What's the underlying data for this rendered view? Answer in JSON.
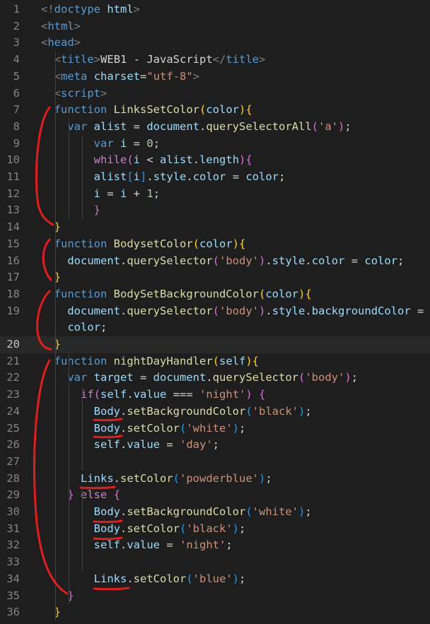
{
  "editor": {
    "current_line": 20,
    "lines": [
      {
        "n": "1",
        "tokens": [
          [
            "tok-punct",
            "<!"
          ],
          [
            "tok-tag",
            "doctype"
          ],
          [
            "tok-plain",
            " "
          ],
          [
            "tok-attr",
            "html"
          ],
          [
            "tok-punct",
            ">"
          ]
        ]
      },
      {
        "n": "2",
        "tokens": [
          [
            "tok-punct",
            "<"
          ],
          [
            "tok-tag",
            "html"
          ],
          [
            "tok-punct",
            ">"
          ]
        ]
      },
      {
        "n": "3",
        "tokens": [
          [
            "tok-punct",
            "<"
          ],
          [
            "tok-tag",
            "head"
          ],
          [
            "tok-punct",
            ">"
          ]
        ]
      },
      {
        "n": "4",
        "tokens": [
          [
            "tok-plain",
            "  "
          ],
          [
            "tok-punct",
            "<"
          ],
          [
            "tok-tag",
            "title"
          ],
          [
            "tok-punct",
            ">"
          ],
          [
            "tok-plain",
            "WEB1 - JavaScript"
          ],
          [
            "tok-punct",
            "</"
          ],
          [
            "tok-tag",
            "title"
          ],
          [
            "tok-punct",
            ">"
          ]
        ]
      },
      {
        "n": "5",
        "tokens": [
          [
            "tok-plain",
            "  "
          ],
          [
            "tok-punct",
            "<"
          ],
          [
            "tok-tag",
            "meta"
          ],
          [
            "tok-plain",
            " "
          ],
          [
            "tok-attr",
            "charset"
          ],
          [
            "tok-plain",
            "="
          ],
          [
            "tok-str",
            "\"utf-8\""
          ],
          [
            "tok-punct",
            ">"
          ]
        ]
      },
      {
        "n": "6",
        "tokens": [
          [
            "tok-plain",
            "  "
          ],
          [
            "tok-punct",
            "<"
          ],
          [
            "tok-tag",
            "script"
          ],
          [
            "tok-punct",
            ">"
          ]
        ]
      },
      {
        "n": "7",
        "tokens": [
          [
            "tok-plain",
            "  "
          ],
          [
            "tok-kw",
            "function"
          ],
          [
            "tok-plain",
            " "
          ],
          [
            "tok-fn",
            "LinksSetColor"
          ],
          [
            "tok-b1",
            "("
          ],
          [
            "tok-var",
            "color"
          ],
          [
            "tok-b1",
            ")"
          ],
          [
            "tok-b1",
            "{"
          ]
        ]
      },
      {
        "n": "8",
        "tokens": [
          [
            "tok-plain",
            "    "
          ],
          [
            "tok-kw",
            "var"
          ],
          [
            "tok-plain",
            " "
          ],
          [
            "tok-var",
            "alist"
          ],
          [
            "tok-plain",
            " = "
          ],
          [
            "tok-var",
            "document"
          ],
          [
            "tok-plain",
            "."
          ],
          [
            "tok-fn",
            "querySelectorAll"
          ],
          [
            "tok-b2",
            "("
          ],
          [
            "tok-str",
            "'a'"
          ],
          [
            "tok-b2",
            ")"
          ],
          [
            "tok-plain",
            ";"
          ]
        ]
      },
      {
        "n": "9",
        "tokens": [
          [
            "tok-plain",
            "        "
          ],
          [
            "tok-kw",
            "var"
          ],
          [
            "tok-plain",
            " "
          ],
          [
            "tok-var",
            "i"
          ],
          [
            "tok-plain",
            " = "
          ],
          [
            "tok-num",
            "0"
          ],
          [
            "tok-plain",
            ";"
          ]
        ]
      },
      {
        "n": "10",
        "tokens": [
          [
            "tok-plain",
            "        "
          ],
          [
            "tok-ctrl",
            "while"
          ],
          [
            "tok-b2",
            "("
          ],
          [
            "tok-var",
            "i"
          ],
          [
            "tok-plain",
            " < "
          ],
          [
            "tok-var",
            "alist"
          ],
          [
            "tok-plain",
            "."
          ],
          [
            "tok-var",
            "length"
          ],
          [
            "tok-b2",
            ")"
          ],
          [
            "tok-b2",
            "{"
          ]
        ]
      },
      {
        "n": "11",
        "tokens": [
          [
            "tok-plain",
            "        "
          ],
          [
            "tok-var",
            "alist"
          ],
          [
            "tok-b3",
            "["
          ],
          [
            "tok-var",
            "i"
          ],
          [
            "tok-b3",
            "]"
          ],
          [
            "tok-plain",
            "."
          ],
          [
            "tok-var",
            "style"
          ],
          [
            "tok-plain",
            "."
          ],
          [
            "tok-var",
            "color"
          ],
          [
            "tok-plain",
            " = "
          ],
          [
            "tok-var",
            "color"
          ],
          [
            "tok-plain",
            ";"
          ]
        ]
      },
      {
        "n": "12",
        "tokens": [
          [
            "tok-plain",
            "        "
          ],
          [
            "tok-var",
            "i"
          ],
          [
            "tok-plain",
            " = "
          ],
          [
            "tok-var",
            "i"
          ],
          [
            "tok-plain",
            " + "
          ],
          [
            "tok-num",
            "1"
          ],
          [
            "tok-plain",
            ";"
          ]
        ]
      },
      {
        "n": "13",
        "tokens": [
          [
            "tok-plain",
            "        "
          ],
          [
            "tok-b2",
            "}"
          ]
        ]
      },
      {
        "n": "14",
        "tokens": [
          [
            "tok-plain",
            "  "
          ],
          [
            "tok-b1",
            "}"
          ]
        ]
      },
      {
        "n": "15",
        "tokens": [
          [
            "tok-plain",
            "  "
          ],
          [
            "tok-kw",
            "function"
          ],
          [
            "tok-plain",
            " "
          ],
          [
            "tok-fn",
            "BodysetColor"
          ],
          [
            "tok-b1",
            "("
          ],
          [
            "tok-var",
            "color"
          ],
          [
            "tok-b1",
            ")"
          ],
          [
            "tok-b1",
            "{"
          ]
        ]
      },
      {
        "n": "16",
        "tokens": [
          [
            "tok-plain",
            "    "
          ],
          [
            "tok-var",
            "document"
          ],
          [
            "tok-plain",
            "."
          ],
          [
            "tok-fn",
            "querySelector"
          ],
          [
            "tok-b2",
            "("
          ],
          [
            "tok-str",
            "'body'"
          ],
          [
            "tok-b2",
            ")"
          ],
          [
            "tok-plain",
            "."
          ],
          [
            "tok-var",
            "style"
          ],
          [
            "tok-plain",
            "."
          ],
          [
            "tok-var",
            "color"
          ],
          [
            "tok-plain",
            " = "
          ],
          [
            "tok-var",
            "color"
          ],
          [
            "tok-plain",
            ";"
          ]
        ]
      },
      {
        "n": "17",
        "tokens": [
          [
            "tok-plain",
            "  "
          ],
          [
            "tok-b1",
            "}"
          ]
        ]
      },
      {
        "n": "18",
        "tokens": [
          [
            "tok-plain",
            "  "
          ],
          [
            "tok-kw",
            "function"
          ],
          [
            "tok-plain",
            " "
          ],
          [
            "tok-fn",
            "BodySetBackgroundColor"
          ],
          [
            "tok-b1",
            "("
          ],
          [
            "tok-var",
            "color"
          ],
          [
            "tok-b1",
            ")"
          ],
          [
            "tok-b1",
            "{"
          ]
        ]
      },
      {
        "n": "19",
        "tokens": [
          [
            "tok-plain",
            "    "
          ],
          [
            "tok-var",
            "document"
          ],
          [
            "tok-plain",
            "."
          ],
          [
            "tok-fn",
            "querySelector"
          ],
          [
            "tok-b2",
            "("
          ],
          [
            "tok-str",
            "'body'"
          ],
          [
            "tok-b2",
            ")"
          ],
          [
            "tok-plain",
            "."
          ],
          [
            "tok-var",
            "style"
          ],
          [
            "tok-plain",
            "."
          ],
          [
            "tok-var",
            "backgroundColor"
          ],
          [
            "tok-plain",
            " ="
          ]
        ]
      },
      {
        "n": "",
        "tokens": [
          [
            "tok-plain",
            "    "
          ],
          [
            "tok-var",
            "color"
          ],
          [
            "tok-plain",
            ";"
          ]
        ]
      },
      {
        "n": "20",
        "tokens": [
          [
            "tok-plain",
            "  "
          ],
          [
            "tok-b1",
            "}"
          ]
        ]
      },
      {
        "n": "21",
        "tokens": [
          [
            "tok-plain",
            "  "
          ],
          [
            "tok-kw",
            "function"
          ],
          [
            "tok-plain",
            " "
          ],
          [
            "tok-fn",
            "nightDayHandler"
          ],
          [
            "tok-b1",
            "("
          ],
          [
            "tok-var",
            "self"
          ],
          [
            "tok-b1",
            ")"
          ],
          [
            "tok-b1",
            "{"
          ]
        ]
      },
      {
        "n": "22",
        "tokens": [
          [
            "tok-plain",
            "    "
          ],
          [
            "tok-kw",
            "var"
          ],
          [
            "tok-plain",
            " "
          ],
          [
            "tok-var",
            "target"
          ],
          [
            "tok-plain",
            " = "
          ],
          [
            "tok-var",
            "document"
          ],
          [
            "tok-plain",
            "."
          ],
          [
            "tok-fn",
            "querySelector"
          ],
          [
            "tok-b2",
            "("
          ],
          [
            "tok-str",
            "'body'"
          ],
          [
            "tok-b2",
            ")"
          ],
          [
            "tok-plain",
            ";"
          ]
        ]
      },
      {
        "n": "23",
        "tokens": [
          [
            "tok-plain",
            "      "
          ],
          [
            "tok-ctrl",
            "if"
          ],
          [
            "tok-b2",
            "("
          ],
          [
            "tok-var",
            "self"
          ],
          [
            "tok-plain",
            "."
          ],
          [
            "tok-var",
            "value"
          ],
          [
            "tok-plain",
            " === "
          ],
          [
            "tok-str",
            "'night'"
          ],
          [
            "tok-b2",
            ")"
          ],
          [
            "tok-plain",
            " "
          ],
          [
            "tok-b2",
            "{"
          ]
        ]
      },
      {
        "n": "24",
        "tokens": [
          [
            "tok-plain",
            "        "
          ],
          [
            "tok-var",
            "Body"
          ],
          [
            "tok-plain",
            "."
          ],
          [
            "tok-fn",
            "setBackgroundColor"
          ],
          [
            "tok-b3",
            "("
          ],
          [
            "tok-str",
            "'black'"
          ],
          [
            "tok-b3",
            ")"
          ],
          [
            "tok-plain",
            ";"
          ]
        ]
      },
      {
        "n": "25",
        "tokens": [
          [
            "tok-plain",
            "        "
          ],
          [
            "tok-var",
            "Body"
          ],
          [
            "tok-plain",
            "."
          ],
          [
            "tok-fn",
            "setColor"
          ],
          [
            "tok-b3",
            "("
          ],
          [
            "tok-str",
            "'white'"
          ],
          [
            "tok-b3",
            ")"
          ],
          [
            "tok-plain",
            ";"
          ]
        ]
      },
      {
        "n": "26",
        "tokens": [
          [
            "tok-plain",
            "        "
          ],
          [
            "tok-var",
            "self"
          ],
          [
            "tok-plain",
            "."
          ],
          [
            "tok-var",
            "value"
          ],
          [
            "tok-plain",
            " = "
          ],
          [
            "tok-str",
            "'day'"
          ],
          [
            "tok-plain",
            ";"
          ]
        ]
      },
      {
        "n": "27",
        "tokens": []
      },
      {
        "n": "28",
        "tokens": [
          [
            "tok-plain",
            "      "
          ],
          [
            "tok-var",
            "Links"
          ],
          [
            "tok-plain",
            "."
          ],
          [
            "tok-fn",
            "setColor"
          ],
          [
            "tok-b3",
            "("
          ],
          [
            "tok-str",
            "'powderblue'"
          ],
          [
            "tok-b3",
            ")"
          ],
          [
            "tok-plain",
            ";"
          ]
        ]
      },
      {
        "n": "29",
        "tokens": [
          [
            "tok-plain",
            "    "
          ],
          [
            "tok-b2",
            "}"
          ],
          [
            "tok-plain",
            " "
          ],
          [
            "tok-ctrl",
            "else"
          ],
          [
            "tok-plain",
            " "
          ],
          [
            "tok-b2",
            "{"
          ]
        ]
      },
      {
        "n": "30",
        "tokens": [
          [
            "tok-plain",
            "        "
          ],
          [
            "tok-var",
            "Body"
          ],
          [
            "tok-plain",
            "."
          ],
          [
            "tok-fn",
            "setBackgroundColor"
          ],
          [
            "tok-b3",
            "("
          ],
          [
            "tok-str",
            "'white'"
          ],
          [
            "tok-b3",
            ")"
          ],
          [
            "tok-plain",
            ";"
          ]
        ]
      },
      {
        "n": "31",
        "tokens": [
          [
            "tok-plain",
            "        "
          ],
          [
            "tok-var",
            "Body"
          ],
          [
            "tok-plain",
            "."
          ],
          [
            "tok-fn",
            "setColor"
          ],
          [
            "tok-b3",
            "("
          ],
          [
            "tok-str",
            "'black'"
          ],
          [
            "tok-b3",
            ")"
          ],
          [
            "tok-plain",
            ";"
          ]
        ]
      },
      {
        "n": "32",
        "tokens": [
          [
            "tok-plain",
            "        "
          ],
          [
            "tok-var",
            "self"
          ],
          [
            "tok-plain",
            "."
          ],
          [
            "tok-var",
            "value"
          ],
          [
            "tok-plain",
            " = "
          ],
          [
            "tok-str",
            "'night'"
          ],
          [
            "tok-plain",
            ";"
          ]
        ]
      },
      {
        "n": "33",
        "tokens": []
      },
      {
        "n": "34",
        "tokens": [
          [
            "tok-plain",
            "        "
          ],
          [
            "tok-var",
            "Links"
          ],
          [
            "tok-plain",
            "."
          ],
          [
            "tok-fn",
            "setColor"
          ],
          [
            "tok-b3",
            "("
          ],
          [
            "tok-str",
            "'blue'"
          ],
          [
            "tok-b3",
            ")"
          ],
          [
            "tok-plain",
            ";"
          ]
        ]
      },
      {
        "n": "35",
        "tokens": [
          [
            "tok-plain",
            "    "
          ],
          [
            "tok-b2",
            "}"
          ]
        ]
      },
      {
        "n": "36",
        "tokens": [
          [
            "tok-plain",
            "  "
          ],
          [
            "tok-b1",
            "}"
          ]
        ]
      }
    ]
  },
  "colors": {
    "background": "#1e1e1e",
    "annotation": "#e51c1c",
    "line_number": "#858585",
    "keyword": "#569cd6",
    "function": "#dcdcaa",
    "string": "#ce9178",
    "variable": "#9cdcfe"
  }
}
